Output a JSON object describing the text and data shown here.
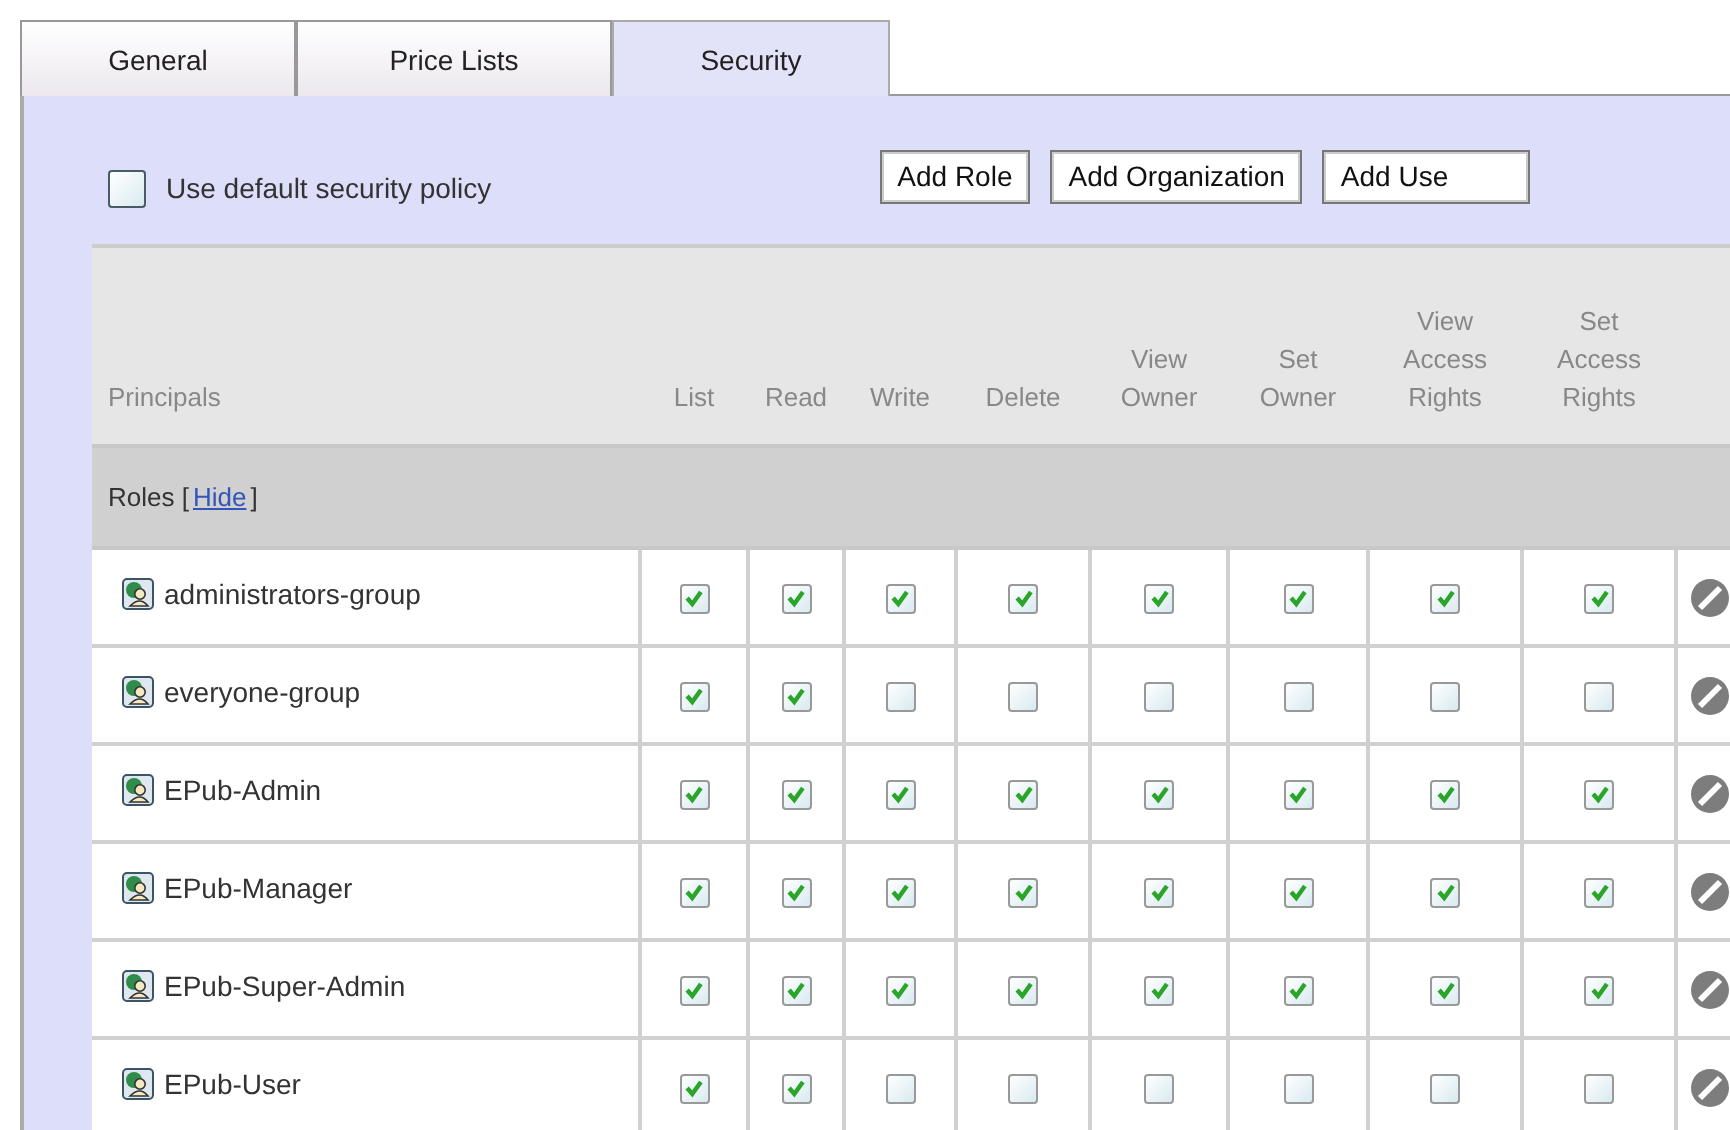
{
  "tabs": [
    {
      "label": "General",
      "selected": false
    },
    {
      "label": "Price Lists",
      "selected": false
    },
    {
      "label": "Security",
      "selected": true
    }
  ],
  "default_policy": {
    "label": "Use default security policy",
    "checked": false
  },
  "buttons": [
    "Add Role",
    "Add Organization",
    "Add Use"
  ],
  "table": {
    "columns": [
      "Principals",
      "List",
      "Read",
      "Write",
      "Delete",
      "View Owner",
      "Set Owner",
      "View Access Rights",
      "Set Access Rights"
    ],
    "group": {
      "label": "Roles [",
      "link": "Hide",
      "label_end": "]"
    },
    "rows": [
      {
        "name": "administrators-group",
        "permissions": [
          true,
          true,
          true,
          true,
          true,
          true,
          true,
          true
        ]
      },
      {
        "name": "everyone-group",
        "permissions": [
          true,
          true,
          false,
          false,
          false,
          false,
          false,
          false
        ]
      },
      {
        "name": "EPub-Admin",
        "permissions": [
          true,
          true,
          true,
          true,
          true,
          true,
          true,
          true
        ]
      },
      {
        "name": "EPub-Manager",
        "permissions": [
          true,
          true,
          true,
          true,
          true,
          true,
          true,
          true
        ]
      },
      {
        "name": "EPub-Super-Admin",
        "permissions": [
          true,
          true,
          true,
          true,
          true,
          true,
          true,
          true
        ]
      },
      {
        "name": "EPub-User",
        "permissions": [
          true,
          true,
          false,
          false,
          false,
          false,
          false,
          false
        ]
      }
    ]
  }
}
